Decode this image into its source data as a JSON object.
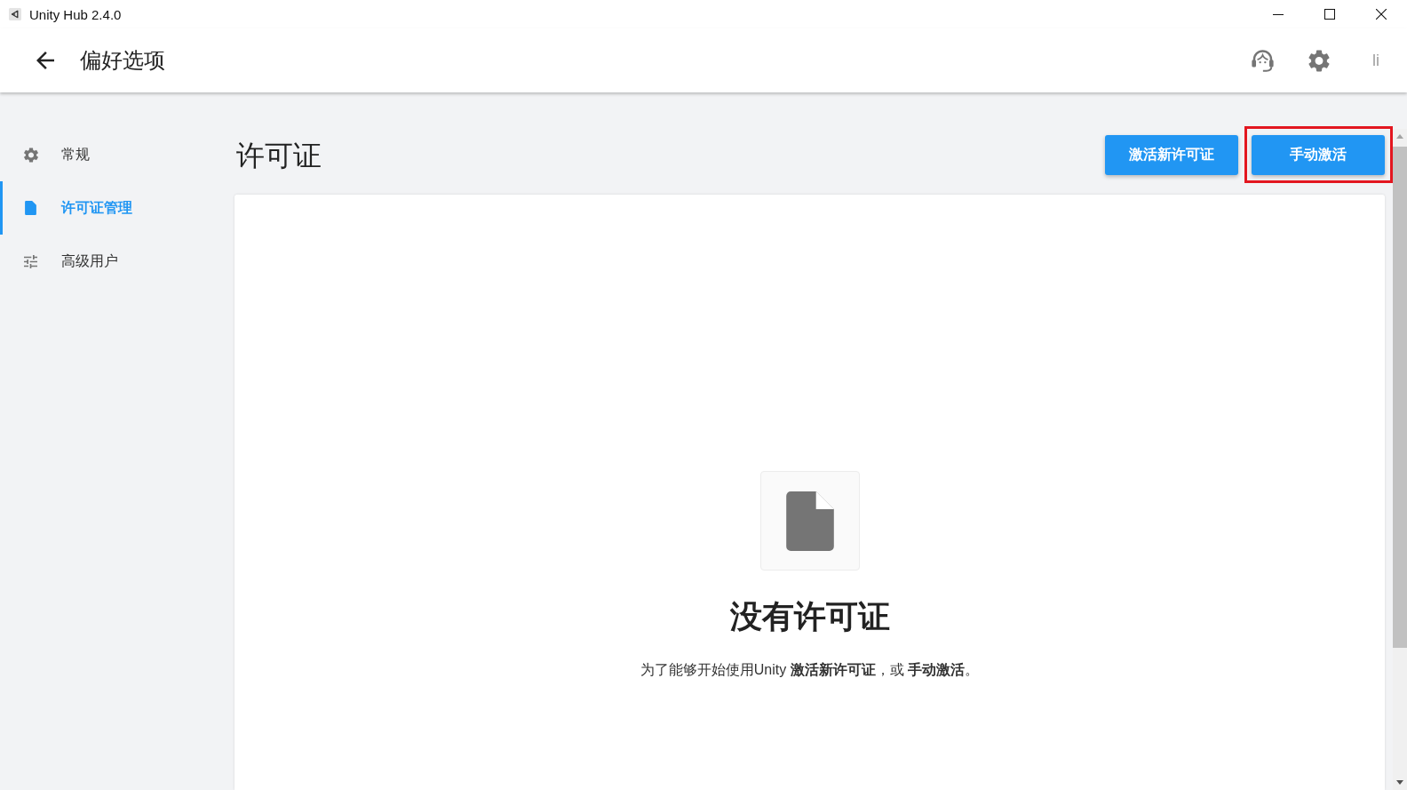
{
  "window": {
    "title": "Unity Hub 2.4.0"
  },
  "header": {
    "title": "偏好选项",
    "account_initials": "li"
  },
  "sidebar": {
    "items": [
      {
        "label": "常规",
        "selected": false
      },
      {
        "label": "许可证管理",
        "selected": true
      },
      {
        "label": "高级用户",
        "selected": false
      }
    ]
  },
  "license_page": {
    "title": "许可证",
    "buttons": [
      {
        "label": "激活新许可证",
        "highlighted": false
      },
      {
        "label": "手动激活",
        "highlighted": true
      }
    ]
  },
  "empty_state": {
    "title": "没有许可证",
    "message": "为了能够开始使用Unity **激活新许可证**，或 **手动激活**。"
  }
}
